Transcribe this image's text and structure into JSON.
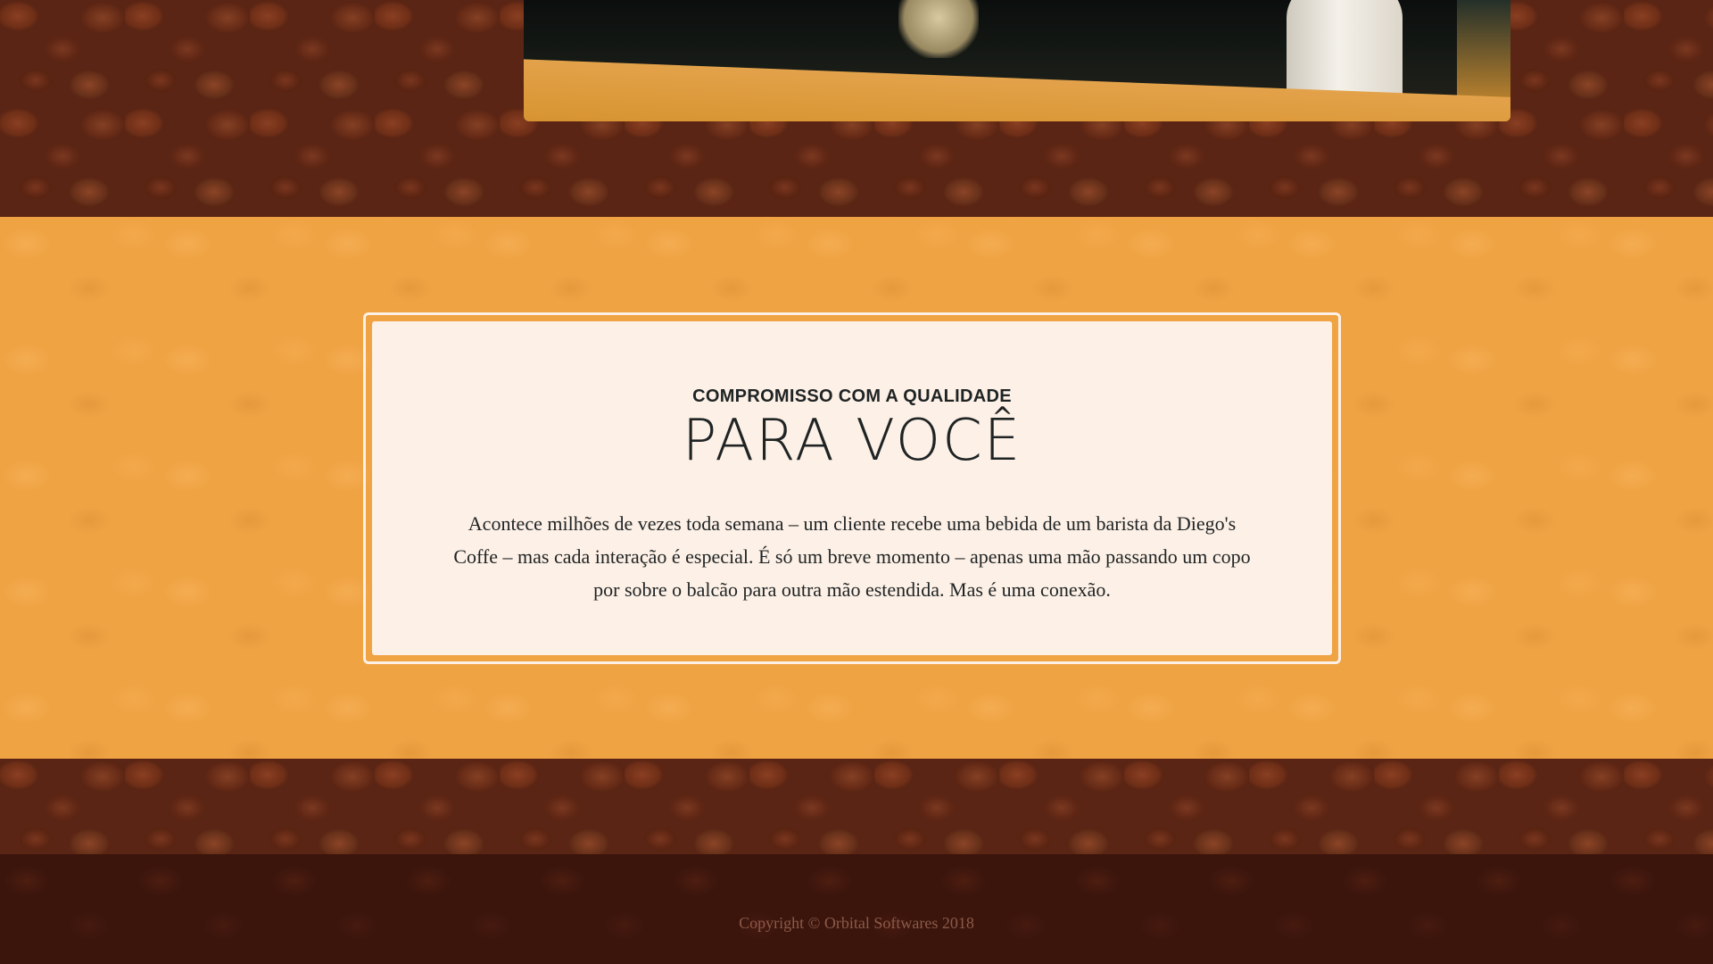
{
  "about_section": {
    "subtitle": "COMPROMISSO COM A QUALIDADE",
    "title": "PARA VOCÊ",
    "text": "Acontece milhões de vezes toda semana – um cliente recebe uma bebida de um barista da Diego's Coffe – mas cada interação é especial. É só um breve momento – apenas uma mão passando um copo por sobre o balcão para outra mão estendida. Mas é uma conexão."
  },
  "footer": {
    "copyright": "Copyright © Orbital Softwares 2018"
  },
  "colors": {
    "orange_band": "#efa343",
    "card_background": "#fdf0e6",
    "text_dark": "#1e2324",
    "footer_background": "#3b150c",
    "footer_text": "#8c5a48"
  }
}
